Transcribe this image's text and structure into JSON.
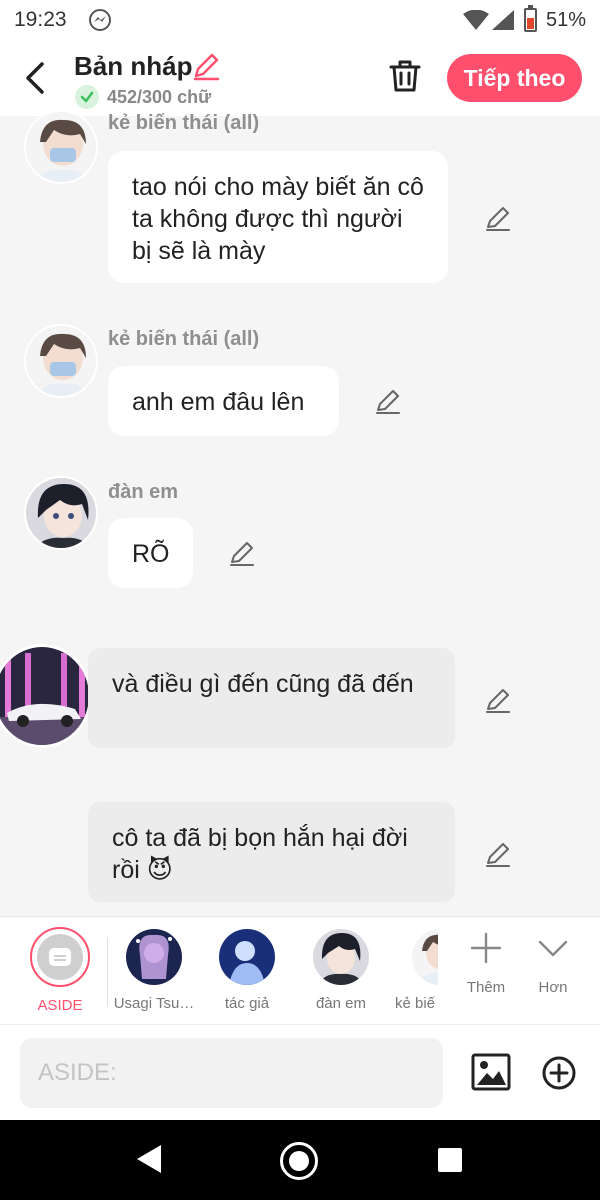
{
  "status_bar": {
    "time": "19:23",
    "battery": "51%"
  },
  "header": {
    "title": "Bản nháp",
    "word_count": "452/300 chữ",
    "next_label": "Tiếp theo"
  },
  "messages": [
    {
      "name": "kẻ biến thái (all)",
      "text": "tao nói cho mày biết ăn cô ta không được thì người bị sẽ là mày"
    },
    {
      "name": "kẻ biến thái (all)",
      "text": "anh em đâu lên"
    },
    {
      "name": "đàn em",
      "text": "RÕ"
    },
    {
      "text": "và điều gì đến cũng đã đến"
    },
    {
      "text": "cô ta đã bị bọn hắn hại đời rồi 😈"
    }
  ],
  "characters": [
    {
      "label": "ASIDE"
    },
    {
      "label": "Usagi Tsu…"
    },
    {
      "label": "tác giả"
    },
    {
      "label": "đàn em"
    },
    {
      "label": "kẻ biế"
    }
  ],
  "actions": {
    "more_label": "Thêm",
    "expand_label": "Hơn"
  },
  "composer": {
    "placeholder": "ASIDE:"
  },
  "colors": {
    "accent": "#ff4f6d",
    "bubble_grey": "#ececec",
    "background": "#f5f5f5"
  }
}
